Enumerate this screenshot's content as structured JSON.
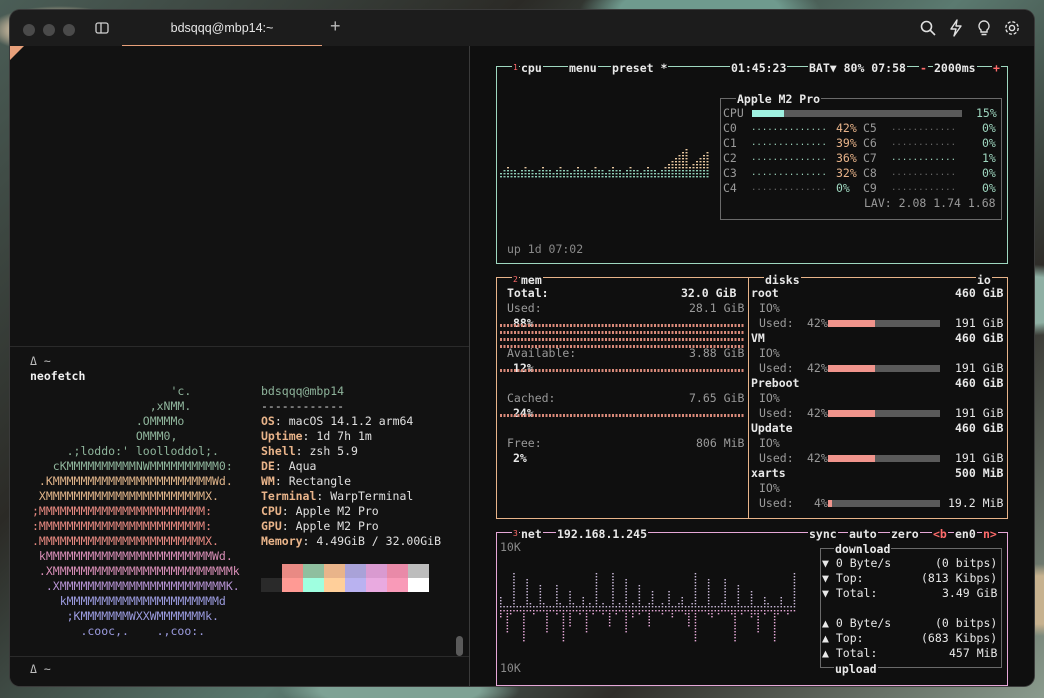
{
  "window": {
    "tab_title": "bdsqqq@mbp14:~"
  },
  "icons": {
    "sidebar": "sidebar-icon",
    "search": "search-icon",
    "bolt": "bolt-icon",
    "bulb": "lightbulb-icon",
    "gear": "gear-icon"
  },
  "terminal": {
    "prompt1": "Δ ~",
    "command": "neofetch",
    "prompt2": "Δ ~",
    "ascii": [
      {
        "text": "                    'c.",
        "color": "#8fb59c"
      },
      {
        "text": "                 ,xNMM.",
        "color": "#8fb59c"
      },
      {
        "text": "               .OMMMMo",
        "color": "#8fb59c"
      },
      {
        "text": "               OMMM0,",
        "color": "#8fb59c"
      },
      {
        "text": "     .;loddo:' loolloddol;.",
        "color": "#8fb59c"
      },
      {
        "text": "   cKMMMMMMMMMMNWMMMMMMMMMM0:",
        "color": "#8fb59c"
      },
      {
        "text": " .KMMMMMMMMMMMMMMMMMMMMMMMWd.",
        "color": "#e0b48a"
      },
      {
        "text": " XMMMMMMMMMMMMMMMMMMMMMMMX.",
        "color": "#e0b48a"
      },
      {
        "text": ";MMMMMMMMMMMMMMMMMMMMMMMM:",
        "color": "#e88a82"
      },
      {
        "text": ":MMMMMMMMMMMMMMMMMMMMMMMM:",
        "color": "#e88a82"
      },
      {
        "text": ".MMMMMMMMMMMMMMMMMMMMMMMMX.",
        "color": "#e88a82"
      },
      {
        "text": " kMMMMMMMMMMMMMMMMMMMMMMMMWd.",
        "color": "#d98fb8"
      },
      {
        "text": " .XMMMMMMMMMMMMMMMMMMMMMMMMMMk",
        "color": "#d98fb8"
      },
      {
        "text": "  .XMMMMMMMMMMMMMMMMMMMMMMMMK.",
        "color": "#b794d4"
      },
      {
        "text": "    kMMMMMMMMMMMMMMMMMMMMMMd",
        "color": "#9c9ce0"
      },
      {
        "text": "     ;KMMMMMMMWXXWMMMMMMMk.",
        "color": "#9c9ce0"
      },
      {
        "text": "       .cooc,.    .,coo:.",
        "color": "#9c9ce0"
      }
    ],
    "user_host": "bdsqqq@mbp14",
    "separator": "------------",
    "info": [
      {
        "key": "OS",
        "value": "macOS 14.1.2 arm64"
      },
      {
        "key": "Uptime",
        "value": "1d 7h 1m"
      },
      {
        "key": "Shell",
        "value": "zsh 5.9"
      },
      {
        "key": "DE",
        "value": "Aqua"
      },
      {
        "key": "WM",
        "value": "Rectangle"
      },
      {
        "key": "Terminal",
        "value": "WarpTerminal"
      },
      {
        "key": "CPU",
        "value": "Apple M2 Pro"
      },
      {
        "key": "GPU",
        "value": "Apple M2 Pro"
      },
      {
        "key": "Memory",
        "value": "4.49GiB / 32.00GiB"
      }
    ],
    "palette_top": [
      "#121212",
      "#e98a84",
      "#8fbf9f",
      "#e9b48a",
      "#a9a2d8",
      "#d99ad0",
      "#e98aa8",
      "#bdbdbd"
    ],
    "palette_bottom": [
      "#2a2a2a",
      "#ff9a94",
      "#9fffe0",
      "#ffcf9a",
      "#b9b2f0",
      "#e9aae0",
      "#f99ab8",
      "#ffffff"
    ]
  },
  "btop": {
    "colors": {
      "cpu": "#9fd8c0",
      "mem": "#e9b48a",
      "net": "#e6a8d8",
      "accent": "#ff6b6b",
      "white": "#e8e8e8",
      "dim": "#8a8a8a"
    },
    "cpu": {
      "tab_cpu": "cpu",
      "tab_menu": "menu",
      "tab_preset": "preset *",
      "sup1": "1",
      "time": "01:45:23",
      "battery": "BAT▼ 80% 07:58",
      "interval": "2000ms",
      "minus": "-",
      "plus": "+",
      "chip": "Apple M2 Pro",
      "total_label": "CPU",
      "total_pct": "15%",
      "total_value": 15,
      "cores_left": [
        {
          "name": "C0",
          "pct": "42%",
          "value": 42
        },
        {
          "name": "C1",
          "pct": "39%",
          "value": 39
        },
        {
          "name": "C2",
          "pct": "36%",
          "value": 36
        },
        {
          "name": "C3",
          "pct": "32%",
          "value": 32
        },
        {
          "name": "C4",
          "pct": "0%",
          "value": 0
        }
      ],
      "cores_right": [
        {
          "name": "C5",
          "pct": "0%",
          "value": 0
        },
        {
          "name": "C6",
          "pct": "0%",
          "value": 0
        },
        {
          "name": "C7",
          "pct": "1%",
          "value": 1
        },
        {
          "name": "C8",
          "pct": "0%",
          "value": 0
        },
        {
          "name": "C9",
          "pct": "0%",
          "value": 0
        }
      ],
      "lav": "LAV: 2.08 1.74 1.68",
      "uptime": "up 1d 07:02"
    },
    "mem": {
      "title": "mem",
      "sup2": "2",
      "total_label": "Total:",
      "total_value": "32.0 GiB",
      "used_label": "Used:",
      "used_value": "28.1 GiB",
      "used_pct": "88%",
      "available_label": "Available:",
      "available_value": "3.88 GiB",
      "available_pct": "12%",
      "cached_label": "Cached:",
      "cached_value": "7.65 GiB",
      "cached_pct": "24%",
      "free_label": "Free:",
      "free_value": "806 MiB",
      "free_pct": "2%"
    },
    "disks": {
      "title": "disks",
      "io": "io",
      "io_label": "IO%",
      "used_label": "Used:",
      "items": [
        {
          "name": "root",
          "size": "460 GiB",
          "pct": "42%",
          "used": "191 GiB",
          "value": 42
        },
        {
          "name": "VM",
          "size": "460 GiB",
          "pct": "42%",
          "used": "191 GiB",
          "value": 42
        },
        {
          "name": "Preboot",
          "size": "460 GiB",
          "pct": "42%",
          "used": "191 GiB",
          "value": 42
        },
        {
          "name": "Update",
          "size": "460 GiB",
          "pct": "42%",
          "used": "191 GiB",
          "value": 42
        },
        {
          "name": "xarts",
          "size": "500 MiB",
          "pct": "4%",
          "used": "19.2 MiB",
          "value": 4
        }
      ]
    },
    "net": {
      "title": "net",
      "sup3": "3",
      "ip": "192.168.1.245",
      "sync": "sync",
      "auto": "auto",
      "zero": "zero",
      "prev": "<b",
      "iface": "en0",
      "next": "n>",
      "scale_top": "10K",
      "scale_bottom": "10K",
      "download_label": "download",
      "upload_label": "upload",
      "down_rate": "0 Byte/s",
      "down_bits": "(0 bitps)",
      "down_top_label": "Top:",
      "down_top": "(813 Kibps)",
      "down_total_label": "Total:",
      "down_total": "3.49 GiB",
      "up_rate": "0 Byte/s",
      "up_bits": "(0 bitps)",
      "up_top_label": "Top:",
      "up_top": "(683 Kibps)",
      "up_total_label": "Total:",
      "up_total": "457 MiB"
    }
  }
}
